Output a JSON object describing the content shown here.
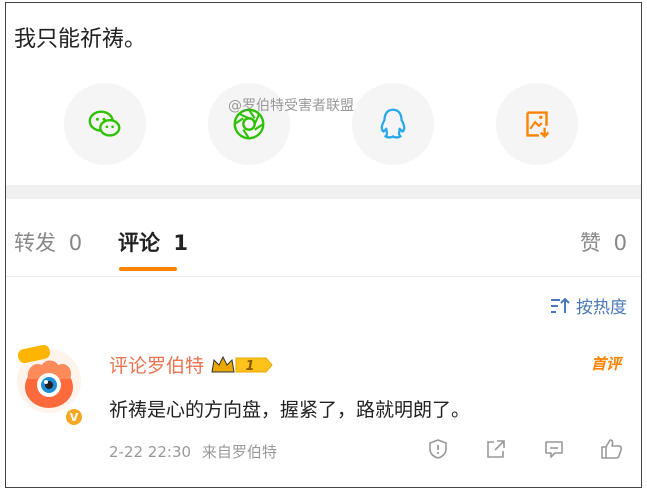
{
  "post": {
    "text": "我只能祈祷。"
  },
  "share": {
    "items": [
      {
        "icon": "wechat-icon",
        "color": "#2dc100"
      },
      {
        "icon": "moments-icon",
        "color": "#2dc100"
      },
      {
        "icon": "qq-icon",
        "color": "#28a8ea"
      },
      {
        "icon": "save-image-icon",
        "color": "#ff8200"
      }
    ],
    "watermark": "@罗伯特受害者联盟"
  },
  "tabs": {
    "repost_label": "转发",
    "repost_count": "0",
    "comment_label": "评论",
    "comment_count": "1",
    "like_label": "赞",
    "like_count": "0"
  },
  "sort": {
    "label": "按热度"
  },
  "comment": {
    "author": "评论罗伯特",
    "vip_level": "1",
    "first_badge": "首评",
    "text": "祈祷是心的方向盘，握紧了，路就明朗了。",
    "time": "2-22 22:30",
    "source": "来自罗伯特",
    "avatar_badge": "V"
  },
  "colors": {
    "accent": "#ff8200",
    "link": "#4a78b8",
    "author": "#eb7350"
  }
}
